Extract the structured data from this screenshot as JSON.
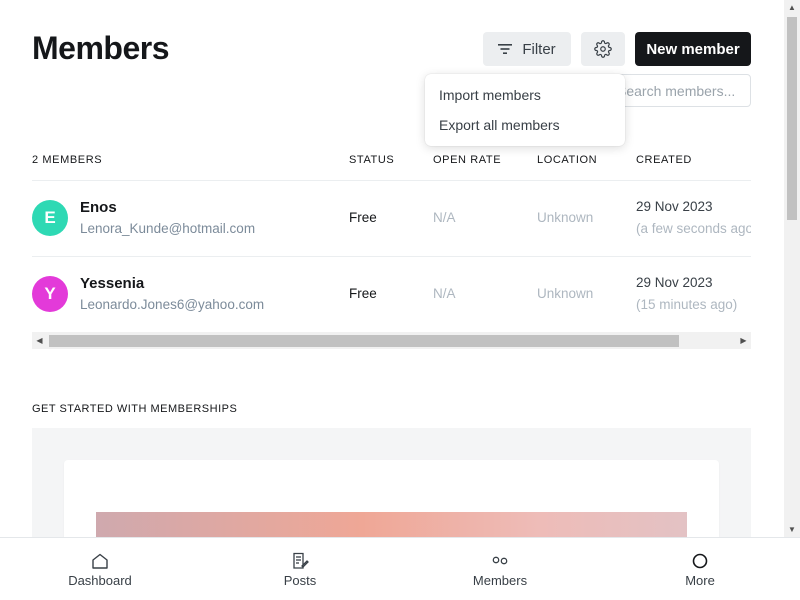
{
  "header": {
    "title": "Members",
    "filter_label": "Filter",
    "new_member_label": "New member"
  },
  "search": {
    "placeholder": "Search members..."
  },
  "dropdown": {
    "items": [
      {
        "label": "Import members"
      },
      {
        "label": "Export all members"
      }
    ]
  },
  "table": {
    "count_label": "2 MEMBERS",
    "columns": [
      "STATUS",
      "OPEN RATE",
      "LOCATION",
      "CREATED"
    ],
    "rows": [
      {
        "initial": "E",
        "avatar_color": "#2ed9b4",
        "name": "Enos",
        "email": "Lenora_Kunde@hotmail.com",
        "status": "Free",
        "open_rate": "N/A",
        "location": "Unknown",
        "created": "29 Nov 2023",
        "created_ago": "(a few seconds ago)"
      },
      {
        "initial": "Y",
        "avatar_color": "#e33ad9",
        "name": "Yessenia",
        "email": "Leonardo.Jones6@yahoo.com",
        "status": "Free",
        "open_rate": "N/A",
        "location": "Unknown",
        "created": "29 Nov 2023",
        "created_ago": "(15 minutes ago)"
      }
    ]
  },
  "get_started": {
    "label": "GET STARTED WITH MEMBERSHIPS"
  },
  "bottom_nav": {
    "items": [
      {
        "label": "Dashboard",
        "icon": "home-icon"
      },
      {
        "label": "Posts",
        "icon": "posts-icon"
      },
      {
        "label": "Members",
        "icon": "members-icon"
      },
      {
        "label": "More",
        "icon": "more-icon"
      }
    ]
  },
  "colors": {
    "primary_dark": "#15171a",
    "muted_text": "#7c8b9a",
    "button_bg": "#eceef0"
  }
}
